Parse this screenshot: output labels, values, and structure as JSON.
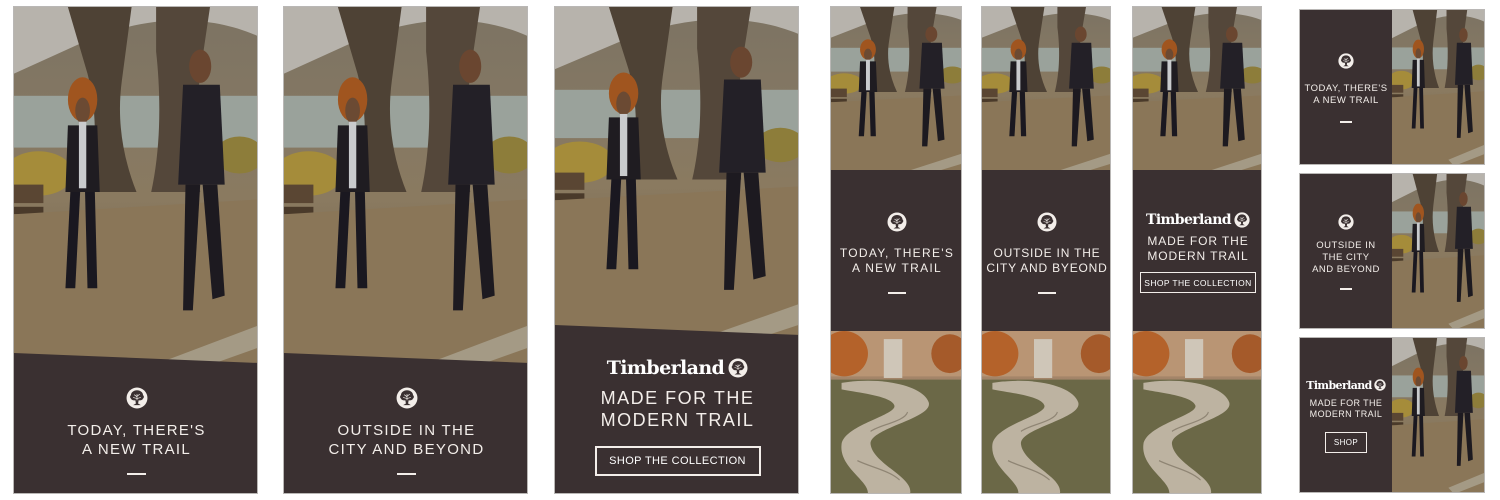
{
  "brand": {
    "logo_text": "Timberland",
    "colors": {
      "panel": "#3a3031",
      "text": "#f3eeea"
    }
  },
  "icons": {
    "logo": "timberland-tree-icon"
  },
  "banners": {
    "b1": {
      "headline": "TODAY, THERE'S\nA NEW TRAIL"
    },
    "b2": {
      "headline": "OUTSIDE IN THE\nCITY AND BEYOND"
    },
    "b3": {
      "logo": "Timberland",
      "headline": "MADE FOR THE\nMODERN TRAIL",
      "cta": "SHOP THE COLLECTION"
    },
    "s1": {
      "headline": "TODAY, THERE'S\nA NEW TRAIL"
    },
    "s2": {
      "headline": "OUTSIDE IN THE\nCITY AND BYEOND"
    },
    "s3": {
      "logo": "Timberland",
      "headline": "MADE FOR THE\nMODERN TRAIL",
      "cta": "SHOP THE COLLECTION"
    },
    "r1": {
      "headline": "TODAY, THERE'S\nA NEW TRAIL"
    },
    "r2": {
      "headline": "OUTSIDE IN\nTHE CITY\nAND BEYOND"
    },
    "r3": {
      "logo": "Timberland",
      "headline": "MADE FOR THE\nMODERN TRAIL",
      "cta": "SHOP"
    }
  }
}
